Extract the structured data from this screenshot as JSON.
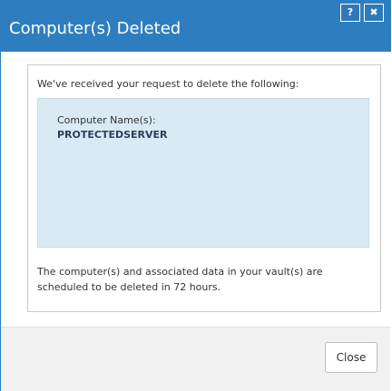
{
  "dialog": {
    "title": "Computer(s) Deleted",
    "help_label": "?",
    "close_icon_label": "✖",
    "intro": "We've received your request to delete the following:",
    "name_label": "Computer Name(s):",
    "name_value": "PROTECTEDSERVER",
    "note": "The computer(s) and associated data in your vault(s) are scheduled to be deleted in 72 hours.",
    "close_button": "Close"
  },
  "icons": {
    "help": "help-icon",
    "close": "close-icon"
  },
  "colors": {
    "titlebar": "#2e7ebf",
    "infobox": "#d9eaf5",
    "footer": "#f1f1f1"
  }
}
